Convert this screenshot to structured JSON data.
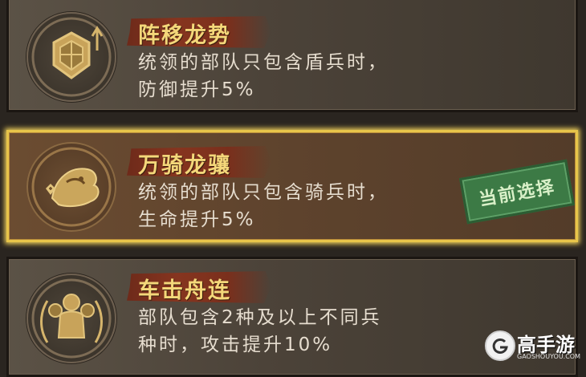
{
  "skills": [
    {
      "title": "阵移龙势",
      "desc_line1": "统领的部队只包含盾兵时，",
      "desc_line2": "防御提升5%",
      "icon": "tortoise-shell-icon",
      "selected": false
    },
    {
      "title": "万骑龙骧",
      "desc_line1": "统领的部队只包含骑兵时，",
      "desc_line2": "生命提升5%",
      "icon": "dragon-horse-icon",
      "selected": true
    },
    {
      "title": "车击舟连",
      "desc_line1": "部队包含2种及以上不同兵",
      "desc_line2": "种时，攻击提升10%",
      "icon": "armored-soldiers-icon",
      "selected": false
    }
  ],
  "current_badge": "当前选择",
  "watermark": {
    "name": "高手游",
    "url": "GAOSHOUYOU.COM"
  },
  "colors": {
    "title_gold": "#f4d77a",
    "banner_red": "#86351f",
    "selected_border": "#e8c54a",
    "badge_green": "#3c7a45"
  }
}
